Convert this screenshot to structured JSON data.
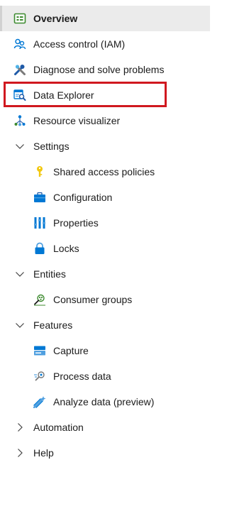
{
  "nav": {
    "overview": {
      "label": "Overview",
      "icon": "overview-icon"
    },
    "access_control": {
      "label": "Access control (IAM)",
      "icon": "people-icon"
    },
    "diagnose": {
      "label": "Diagnose and solve problems",
      "icon": "wrench-icon"
    },
    "data_explorer": {
      "label": "Data Explorer",
      "icon": "data-explorer-icon"
    },
    "resource_visualizer": {
      "label": "Resource visualizer",
      "icon": "hierarchy-icon"
    },
    "settings": {
      "label": "Settings",
      "expanded": true,
      "items": [
        {
          "label": "Shared access policies",
          "icon": "key-icon"
        },
        {
          "label": "Configuration",
          "icon": "briefcase-icon"
        },
        {
          "label": "Properties",
          "icon": "properties-icon"
        },
        {
          "label": "Locks",
          "icon": "lock-icon"
        }
      ]
    },
    "entities": {
      "label": "Entities",
      "expanded": true,
      "items": [
        {
          "label": "Consumer groups",
          "icon": "consumer-groups-icon"
        }
      ]
    },
    "features": {
      "label": "Features",
      "expanded": true,
      "items": [
        {
          "label": "Capture",
          "icon": "capture-icon"
        },
        {
          "label": "Process data",
          "icon": "process-data-icon"
        },
        {
          "label": "Analyze data (preview)",
          "icon": "analyze-data-icon"
        }
      ]
    },
    "automation": {
      "label": "Automation",
      "expanded": false
    },
    "help": {
      "label": "Help",
      "expanded": false
    }
  },
  "colors": {
    "selected_background": "#ebebeb",
    "highlight_border": "#d0181f",
    "text": "#1b1b1b",
    "azure_blue": "#0078d4"
  }
}
